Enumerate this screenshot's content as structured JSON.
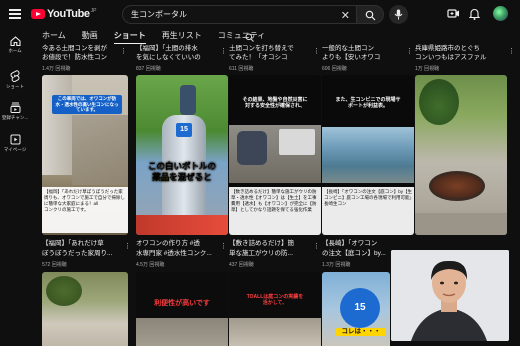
{
  "header": {
    "logo_text": "YouTube",
    "logo_sub": "JP",
    "search_value": "生コンポータル"
  },
  "rail": [
    {
      "label": "ホーム",
      "icon": "home-icon"
    },
    {
      "label": "ショート",
      "icon": "shorts-icon"
    },
    {
      "label": "登録チャン...",
      "icon": "subscriptions-icon"
    },
    {
      "label": "マイページ",
      "icon": "you-icon"
    }
  ],
  "tabs": [
    "ホーム",
    "動画",
    "ショート",
    "再生リスト",
    "コミュニティ"
  ],
  "active_tab": "ショート",
  "row0": [
    {
      "title1": "今ある土間コンを剥が",
      "title2": "お値段で！防水性コン",
      "views": "1.4万 回視聴"
    },
    {
      "title1": "【福岡】「土間の排水",
      "title2": "を気にしなくていいの",
      "views": "837 回視聴"
    },
    {
      "title1": "土間コンを打ち替えで",
      "title2": "てみた！「オコシコ",
      "views": "611 回視聴"
    },
    {
      "title1": "一般的な土間コン",
      "title2": "よりも【安いオワコ",
      "views": "606 回視聴"
    },
    {
      "title1": "兵庫県姫路市のとぐち",
      "title2": "コンいつもはアスファル",
      "views": "1万 回視聴"
    }
  ],
  "row1_thumbs": [
    {
      "caption": "この車両では、オワコンが防\n水・透水性の高い生コンになっ\nています。",
      "subtitle": "【福岡】「あれだけ草ぼうぼうだった家周りも、オワコンで施工で自分で掃除しに簡単な大家庭にまる！all\nコンクリの施工です。"
    },
    {
      "caption_main": "この白いボトルの",
      "caption_hl": "薬品",
      "caption_tail": "を混ぜると"
    },
    {
      "caption": "その結果、地盤や自然災害に\n対する安全性が確保され、",
      "subtitle": "【数き詰めるだけ】簡単な施工がウリの防草・透水性【オワコン】は【生土】を工事費用【透水】も【オワコン】が完全に【防草】としてかなり話題を保てる強化作業"
    },
    {
      "caption": "また、生コンビニでの現場サ\nポートが利益表。",
      "subtitle": "【長崎】「オワコンの注文【庭コン】by【生コンビニ】庭コン工場の各現場で利用可能」長崎生コン"
    },
    {
      "caption": ""
    }
  ],
  "row1": [
    {
      "title1": "【福岡】「あれだけ草",
      "title2": "ぼうぼうだった家周り...",
      "views": "572 回視聴"
    },
    {
      "title1": "オワコンの作り方 #透",
      "title2": "水専門家 #透水性コンク...",
      "views": "4.5万 回視聴"
    },
    {
      "title1": "【敷き詰めるだけ】簡",
      "title2": "単な施工がウリの防...",
      "views": "437 回視聴"
    },
    {
      "title1": "【長崎】「オワコン",
      "title2": "の注文【庭コン】by...",
      "views": "1.3万 回視聴"
    }
  ],
  "row2_thumbs": [
    {
      "caption": ""
    },
    {
      "caption": "利便性が高いです"
    },
    {
      "caption": "TOALLは庭コンの実績を\n活かして、"
    },
    {
      "caption": "コレは・・・"
    }
  ],
  "colors": {
    "accent": "#ff0033",
    "background": "#0f0f0f",
    "highlight_yellow": "#ffd400"
  }
}
